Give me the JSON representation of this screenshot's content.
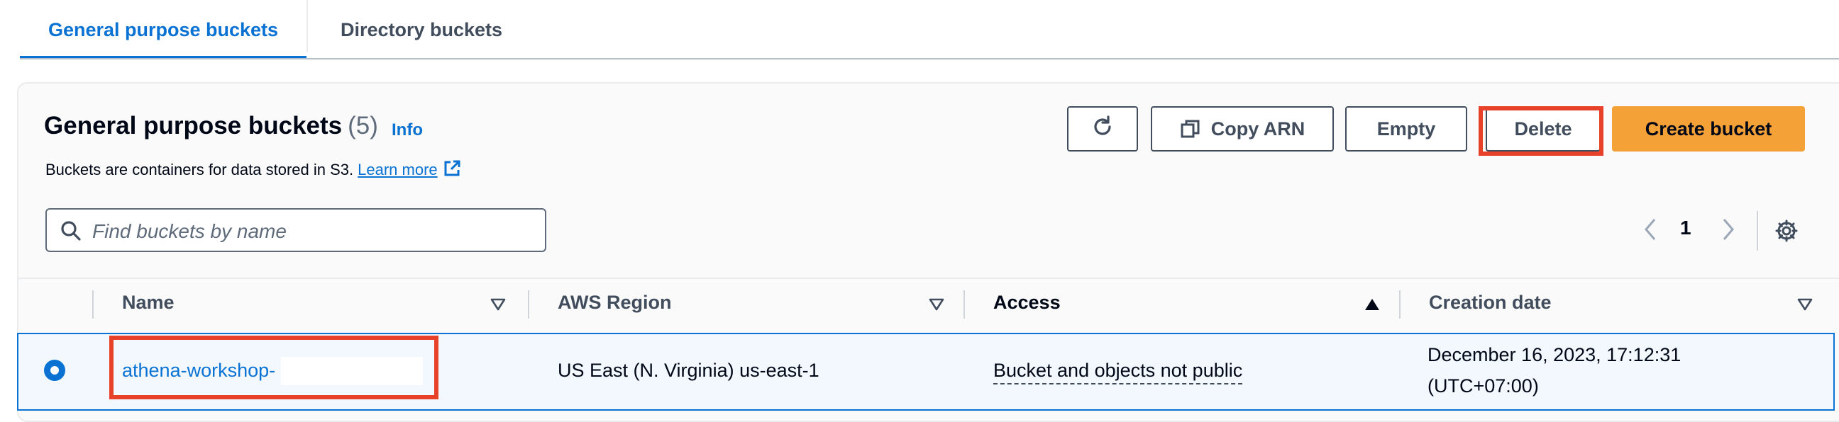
{
  "tabs": [
    {
      "label": "General purpose buckets",
      "active": true
    },
    {
      "label": "Directory buckets",
      "active": false
    }
  ],
  "panel": {
    "title": "General purpose buckets",
    "count": "(5)",
    "info_label": "Info",
    "description": "Buckets are containers for data stored in S3.",
    "learn_more": "Learn more"
  },
  "actions": {
    "refresh_icon": "refresh-icon",
    "copy_arn_label": "Copy ARN",
    "empty_label": "Empty",
    "delete_label": "Delete",
    "create_label": "Create bucket"
  },
  "search": {
    "placeholder": "Find buckets by name",
    "value": ""
  },
  "pagination": {
    "current_page": "1"
  },
  "table": {
    "columns": [
      "Name",
      "AWS Region",
      "Access",
      "Creation date"
    ],
    "rows": [
      {
        "selected": true,
        "name": "athena-workshop-",
        "region": "US East (N. Virginia) us-east-1",
        "access": "Bucket and objects not public",
        "creation_date_line1": "December 16, 2023, 17:12:31",
        "creation_date_line2": "(UTC+07:00)"
      }
    ]
  },
  "colors": {
    "accent": "#0972d3",
    "primary_button": "#f4a138",
    "highlight": "#e8412a"
  }
}
